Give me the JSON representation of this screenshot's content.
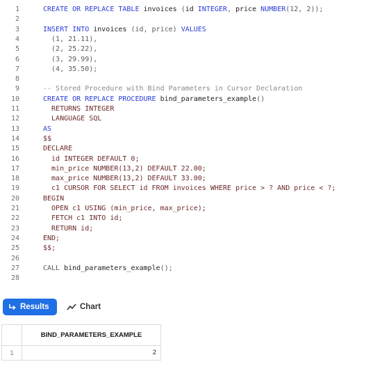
{
  "editor": {
    "line_numbers": [
      "1",
      "2",
      "3",
      "4",
      "5",
      "6",
      "7",
      "8",
      "9",
      "10",
      "11",
      "12",
      "13",
      "14",
      "15",
      "16",
      "17",
      "18",
      "19",
      "20",
      "21",
      "22",
      "23",
      "24",
      "25",
      "26",
      "27",
      "28"
    ],
    "lines": [
      [
        {
          "t": "CREATE OR REPLACE TABLE ",
          "c": "kw"
        },
        {
          "t": "invoices ",
          "c": "id"
        },
        {
          "t": "(",
          "c": "pu"
        },
        {
          "t": "id ",
          "c": "id"
        },
        {
          "t": "INTEGER",
          "c": "kw"
        },
        {
          "t": ", ",
          "c": "pu"
        },
        {
          "t": "price ",
          "c": "id"
        },
        {
          "t": "NUMBER",
          "c": "kw"
        },
        {
          "t": "(12, 2));",
          "c": "pu"
        }
      ],
      [],
      [
        {
          "t": "INSERT INTO ",
          "c": "kw"
        },
        {
          "t": "invoices ",
          "c": "id"
        },
        {
          "t": "(id, price) ",
          "c": "pu"
        },
        {
          "t": "VALUES",
          "c": "kw"
        }
      ],
      [
        {
          "t": "  (1, 21.11),",
          "c": "pu"
        }
      ],
      [
        {
          "t": "  (2, 25.22),",
          "c": "pu"
        }
      ],
      [
        {
          "t": "  (3, 29.99),",
          "c": "pu"
        }
      ],
      [
        {
          "t": "  (4, 35.50);",
          "c": "pu"
        }
      ],
      [],
      [
        {
          "t": "-- Stored Procedure with Bind Parameters in Cursor Declaration",
          "c": "cm"
        }
      ],
      [
        {
          "t": "CREATE OR REPLACE PROCEDURE ",
          "c": "kw"
        },
        {
          "t": "bind_parameters_example",
          "c": "id"
        },
        {
          "t": "()",
          "c": "pu"
        }
      ],
      [
        {
          "t": "  RETURNS INTEGER",
          "c": "ty"
        }
      ],
      [
        {
          "t": "  LANGUAGE SQL",
          "c": "ty"
        }
      ],
      [
        {
          "t": "AS",
          "c": "kw"
        }
      ],
      [
        {
          "t": "$$",
          "c": "ty"
        }
      ],
      [
        {
          "t": "DECLARE",
          "c": "ty"
        }
      ],
      [
        {
          "t": "  id INTEGER DEFAULT 0;",
          "c": "ty"
        }
      ],
      [
        {
          "t": "  min_price NUMBER(13,2) DEFAULT 22.00;",
          "c": "ty"
        }
      ],
      [
        {
          "t": "  max_price NUMBER(13,2) DEFAULT 33.00;",
          "c": "ty"
        }
      ],
      [
        {
          "t": "  c1 CURSOR FOR SELECT id FROM invoices WHERE price > ? AND price < ?;",
          "c": "ty"
        }
      ],
      [
        {
          "t": "BEGIN",
          "c": "ty"
        }
      ],
      [
        {
          "t": "  OPEN c1 USING (min_price, max_price);",
          "c": "ty"
        }
      ],
      [
        {
          "t": "  FETCH c1 INTO id;",
          "c": "ty"
        }
      ],
      [
        {
          "t": "  RETURN id;",
          "c": "ty"
        }
      ],
      [
        {
          "t": "END;",
          "c": "ty"
        }
      ],
      [
        {
          "t": "$$;",
          "c": "ty"
        }
      ],
      [],
      [
        {
          "t": "CALL ",
          "c": "pu"
        },
        {
          "t": "bind_parameters_example",
          "c": "id"
        },
        {
          "t": "();",
          "c": "pu"
        }
      ],
      []
    ]
  },
  "tabs": {
    "results_label": "Results",
    "chart_label": "Chart"
  },
  "result_grid": {
    "columns": [
      "BIND_PARAMETERS_EXAMPLE"
    ],
    "rows": [
      {
        "row_number": "1",
        "values": [
          "2"
        ]
      }
    ]
  },
  "colors": {
    "accent": "#1f6fe5",
    "keyword": "#2a3cd6",
    "comment": "#8a8a8a"
  }
}
